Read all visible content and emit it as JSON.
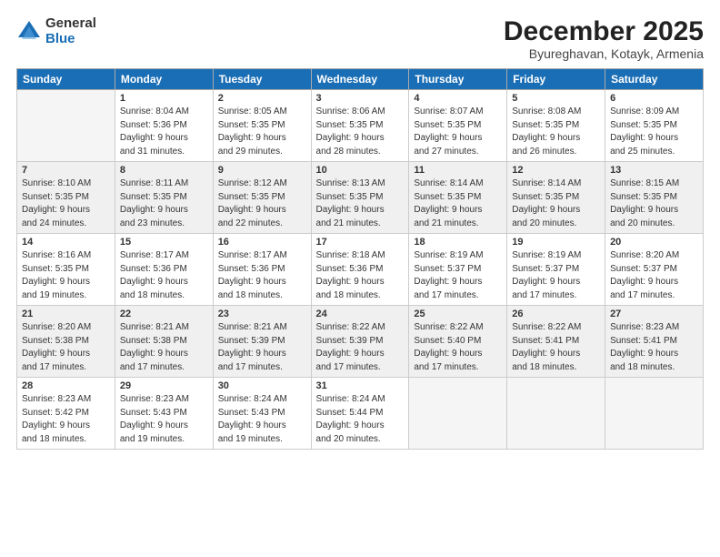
{
  "logo": {
    "general": "General",
    "blue": "Blue"
  },
  "title": "December 2025",
  "subtitle": "Byureghavan, Kotayk, Armenia",
  "weekdays": [
    "Sunday",
    "Monday",
    "Tuesday",
    "Wednesday",
    "Thursday",
    "Friday",
    "Saturday"
  ],
  "weeks": [
    [
      {
        "day": "",
        "sunrise": "",
        "sunset": "",
        "daylight": ""
      },
      {
        "day": "1",
        "sunrise": "Sunrise: 8:04 AM",
        "sunset": "Sunset: 5:36 PM",
        "daylight": "Daylight: 9 hours and 31 minutes."
      },
      {
        "day": "2",
        "sunrise": "Sunrise: 8:05 AM",
        "sunset": "Sunset: 5:35 PM",
        "daylight": "Daylight: 9 hours and 29 minutes."
      },
      {
        "day": "3",
        "sunrise": "Sunrise: 8:06 AM",
        "sunset": "Sunset: 5:35 PM",
        "daylight": "Daylight: 9 hours and 28 minutes."
      },
      {
        "day": "4",
        "sunrise": "Sunrise: 8:07 AM",
        "sunset": "Sunset: 5:35 PM",
        "daylight": "Daylight: 9 hours and 27 minutes."
      },
      {
        "day": "5",
        "sunrise": "Sunrise: 8:08 AM",
        "sunset": "Sunset: 5:35 PM",
        "daylight": "Daylight: 9 hours and 26 minutes."
      },
      {
        "day": "6",
        "sunrise": "Sunrise: 8:09 AM",
        "sunset": "Sunset: 5:35 PM",
        "daylight": "Daylight: 9 hours and 25 minutes."
      }
    ],
    [
      {
        "day": "7",
        "sunrise": "Sunrise: 8:10 AM",
        "sunset": "Sunset: 5:35 PM",
        "daylight": "Daylight: 9 hours and 24 minutes."
      },
      {
        "day": "8",
        "sunrise": "Sunrise: 8:11 AM",
        "sunset": "Sunset: 5:35 PM",
        "daylight": "Daylight: 9 hours and 23 minutes."
      },
      {
        "day": "9",
        "sunrise": "Sunrise: 8:12 AM",
        "sunset": "Sunset: 5:35 PM",
        "daylight": "Daylight: 9 hours and 22 minutes."
      },
      {
        "day": "10",
        "sunrise": "Sunrise: 8:13 AM",
        "sunset": "Sunset: 5:35 PM",
        "daylight": "Daylight: 9 hours and 21 minutes."
      },
      {
        "day": "11",
        "sunrise": "Sunrise: 8:14 AM",
        "sunset": "Sunset: 5:35 PM",
        "daylight": "Daylight: 9 hours and 21 minutes."
      },
      {
        "day": "12",
        "sunrise": "Sunrise: 8:14 AM",
        "sunset": "Sunset: 5:35 PM",
        "daylight": "Daylight: 9 hours and 20 minutes."
      },
      {
        "day": "13",
        "sunrise": "Sunrise: 8:15 AM",
        "sunset": "Sunset: 5:35 PM",
        "daylight": "Daylight: 9 hours and 20 minutes."
      }
    ],
    [
      {
        "day": "14",
        "sunrise": "Sunrise: 8:16 AM",
        "sunset": "Sunset: 5:35 PM",
        "daylight": "Daylight: 9 hours and 19 minutes."
      },
      {
        "day": "15",
        "sunrise": "Sunrise: 8:17 AM",
        "sunset": "Sunset: 5:36 PM",
        "daylight": "Daylight: 9 hours and 18 minutes."
      },
      {
        "day": "16",
        "sunrise": "Sunrise: 8:17 AM",
        "sunset": "Sunset: 5:36 PM",
        "daylight": "Daylight: 9 hours and 18 minutes."
      },
      {
        "day": "17",
        "sunrise": "Sunrise: 8:18 AM",
        "sunset": "Sunset: 5:36 PM",
        "daylight": "Daylight: 9 hours and 18 minutes."
      },
      {
        "day": "18",
        "sunrise": "Sunrise: 8:19 AM",
        "sunset": "Sunset: 5:37 PM",
        "daylight": "Daylight: 9 hours and 17 minutes."
      },
      {
        "day": "19",
        "sunrise": "Sunrise: 8:19 AM",
        "sunset": "Sunset: 5:37 PM",
        "daylight": "Daylight: 9 hours and 17 minutes."
      },
      {
        "day": "20",
        "sunrise": "Sunrise: 8:20 AM",
        "sunset": "Sunset: 5:37 PM",
        "daylight": "Daylight: 9 hours and 17 minutes."
      }
    ],
    [
      {
        "day": "21",
        "sunrise": "Sunrise: 8:20 AM",
        "sunset": "Sunset: 5:38 PM",
        "daylight": "Daylight: 9 hours and 17 minutes."
      },
      {
        "day": "22",
        "sunrise": "Sunrise: 8:21 AM",
        "sunset": "Sunset: 5:38 PM",
        "daylight": "Daylight: 9 hours and 17 minutes."
      },
      {
        "day": "23",
        "sunrise": "Sunrise: 8:21 AM",
        "sunset": "Sunset: 5:39 PM",
        "daylight": "Daylight: 9 hours and 17 minutes."
      },
      {
        "day": "24",
        "sunrise": "Sunrise: 8:22 AM",
        "sunset": "Sunset: 5:39 PM",
        "daylight": "Daylight: 9 hours and 17 minutes."
      },
      {
        "day": "25",
        "sunrise": "Sunrise: 8:22 AM",
        "sunset": "Sunset: 5:40 PM",
        "daylight": "Daylight: 9 hours and 17 minutes."
      },
      {
        "day": "26",
        "sunrise": "Sunrise: 8:22 AM",
        "sunset": "Sunset: 5:41 PM",
        "daylight": "Daylight: 9 hours and 18 minutes."
      },
      {
        "day": "27",
        "sunrise": "Sunrise: 8:23 AM",
        "sunset": "Sunset: 5:41 PM",
        "daylight": "Daylight: 9 hours and 18 minutes."
      }
    ],
    [
      {
        "day": "28",
        "sunrise": "Sunrise: 8:23 AM",
        "sunset": "Sunset: 5:42 PM",
        "daylight": "Daylight: 9 hours and 18 minutes."
      },
      {
        "day": "29",
        "sunrise": "Sunrise: 8:23 AM",
        "sunset": "Sunset: 5:43 PM",
        "daylight": "Daylight: 9 hours and 19 minutes."
      },
      {
        "day": "30",
        "sunrise": "Sunrise: 8:24 AM",
        "sunset": "Sunset: 5:43 PM",
        "daylight": "Daylight: 9 hours and 19 minutes."
      },
      {
        "day": "31",
        "sunrise": "Sunrise: 8:24 AM",
        "sunset": "Sunset: 5:44 PM",
        "daylight": "Daylight: 9 hours and 20 minutes."
      },
      {
        "day": "",
        "sunrise": "",
        "sunset": "",
        "daylight": ""
      },
      {
        "day": "",
        "sunrise": "",
        "sunset": "",
        "daylight": ""
      },
      {
        "day": "",
        "sunrise": "",
        "sunset": "",
        "daylight": ""
      }
    ]
  ]
}
